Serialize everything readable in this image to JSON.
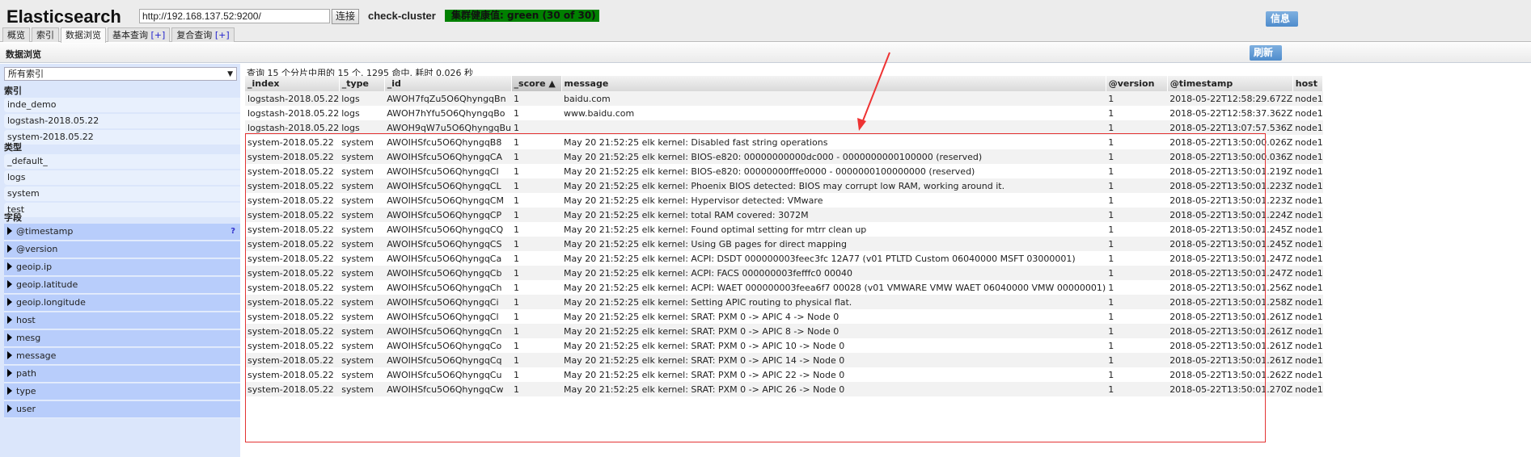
{
  "app": {
    "title": "Elasticsearch",
    "url": "http://192.168.137.52:9200/",
    "connect_label": "连接",
    "cluster_name": "check-cluster",
    "health": "集群健康值: green (30 of 30)",
    "health_color": "#008000",
    "info_label": "信息"
  },
  "tabs": [
    {
      "label": "概览"
    },
    {
      "label": "索引"
    },
    {
      "label": "数据浏览",
      "active": true
    },
    {
      "label": "基本查询",
      "plus": "[+]"
    },
    {
      "label": "复合查询",
      "plus": "[+]"
    }
  ],
  "page": {
    "title": "数据浏览",
    "refresh_label": "刷新"
  },
  "sidebar": {
    "index_select": "所有索引",
    "indices_heading": "索引",
    "indices": [
      "inde_demo",
      "logstash-2018.05.22",
      "system-2018.05.22"
    ],
    "types_heading": "类型",
    "types": [
      "_default_",
      "logs",
      "system",
      "test"
    ],
    "fields_heading": "字段",
    "fields": [
      "@timestamp",
      "@version",
      "geoip.ip",
      "geoip.latitude",
      "geoip.longitude",
      "host",
      "mesg",
      "message",
      "path",
      "type",
      "user"
    ],
    "help_mark": "?"
  },
  "results": {
    "summary": "查询 15 个分片中用的 15 个. 1295 命中. 耗时 0.026 秒",
    "columns": [
      "_index",
      "_type",
      "_id",
      "_score ▲",
      "message",
      "@version",
      "@timestamp",
      "host"
    ],
    "rows": [
      [
        "logstash-2018.05.22",
        "logs",
        "AWOH7fqZu5O6QhyngqBn",
        "1",
        "baidu.com",
        "1",
        "2018-05-22T12:58:29.672Z",
        "node1"
      ],
      [
        "logstash-2018.05.22",
        "logs",
        "AWOH7hYfu5O6QhyngqBo",
        "1",
        "www.baidu.com",
        "1",
        "2018-05-22T12:58:37.362Z",
        "node1"
      ],
      [
        "logstash-2018.05.22",
        "logs",
        "AWOH9qW7u5O6QhyngqBu",
        "1",
        "",
        "1",
        "2018-05-22T13:07:57.536Z",
        "node1"
      ],
      [
        "system-2018.05.22",
        "system",
        "AWOIHSfcu5O6QhyngqB8",
        "1",
        "May 20 21:52:25 elk kernel: Disabled fast string operations",
        "1",
        "2018-05-22T13:50:00.026Z",
        "node1"
      ],
      [
        "system-2018.05.22",
        "system",
        "AWOIHSfcu5O6QhyngqCA",
        "1",
        "May 20 21:52:25 elk kernel: BIOS-e820: 00000000000dc000 - 0000000000100000 (reserved)",
        "1",
        "2018-05-22T13:50:00.036Z",
        "node1"
      ],
      [
        "system-2018.05.22",
        "system",
        "AWOIHSfcu5O6QhyngqCI",
        "1",
        "May 20 21:52:25 elk kernel: BIOS-e820: 00000000fffe0000 - 0000000100000000 (reserved)",
        "1",
        "2018-05-22T13:50:01.219Z",
        "node1"
      ],
      [
        "system-2018.05.22",
        "system",
        "AWOIHSfcu5O6QhyngqCL",
        "1",
        "May 20 21:52:25 elk kernel: Phoenix BIOS detected: BIOS may corrupt low RAM, working around it.",
        "1",
        "2018-05-22T13:50:01.223Z",
        "node1"
      ],
      [
        "system-2018.05.22",
        "system",
        "AWOIHSfcu5O6QhyngqCM",
        "1",
        "May 20 21:52:25 elk kernel: Hypervisor detected: VMware",
        "1",
        "2018-05-22T13:50:01.223Z",
        "node1"
      ],
      [
        "system-2018.05.22",
        "system",
        "AWOIHSfcu5O6QhyngqCP",
        "1",
        "May 20 21:52:25 elk kernel: total RAM covered: 3072M",
        "1",
        "2018-05-22T13:50:01.224Z",
        "node1"
      ],
      [
        "system-2018.05.22",
        "system",
        "AWOIHSfcu5O6QhyngqCQ",
        "1",
        "May 20 21:52:25 elk kernel: Found optimal setting for mtrr clean up",
        "1",
        "2018-05-22T13:50:01.245Z",
        "node1"
      ],
      [
        "system-2018.05.22",
        "system",
        "AWOIHSfcu5O6QhyngqCS",
        "1",
        "May 20 21:52:25 elk kernel: Using GB pages for direct mapping",
        "1",
        "2018-05-22T13:50:01.245Z",
        "node1"
      ],
      [
        "system-2018.05.22",
        "system",
        "AWOIHSfcu5O6QhyngqCa",
        "1",
        "May 20 21:52:25 elk kernel: ACPI: DSDT 000000003feec3fc 12A77 (v01 PTLTD Custom 06040000 MSFT 03000001)",
        "1",
        "2018-05-22T13:50:01.247Z",
        "node1"
      ],
      [
        "system-2018.05.22",
        "system",
        "AWOIHSfcu5O6QhyngqCb",
        "1",
        "May 20 21:52:25 elk kernel: ACPI: FACS 000000003fefffc0 00040",
        "1",
        "2018-05-22T13:50:01.247Z",
        "node1"
      ],
      [
        "system-2018.05.22",
        "system",
        "AWOIHSfcu5O6QhyngqCh",
        "1",
        "May 20 21:52:25 elk kernel: ACPI: WAET 000000003feea6f7 00028 (v01 VMWARE VMW WAET 06040000 VMW 00000001)",
        "1",
        "2018-05-22T13:50:01.256Z",
        "node1"
      ],
      [
        "system-2018.05.22",
        "system",
        "AWOIHSfcu5O6QhyngqCi",
        "1",
        "May 20 21:52:25 elk kernel: Setting APIC routing to physical flat.",
        "1",
        "2018-05-22T13:50:01.258Z",
        "node1"
      ],
      [
        "system-2018.05.22",
        "system",
        "AWOIHSfcu5O6QhyngqCl",
        "1",
        "May 20 21:52:25 elk kernel: SRAT: PXM 0 -> APIC 4 -> Node 0",
        "1",
        "2018-05-22T13:50:01.261Z",
        "node1"
      ],
      [
        "system-2018.05.22",
        "system",
        "AWOIHSfcu5O6QhyngqCn",
        "1",
        "May 20 21:52:25 elk kernel: SRAT: PXM 0 -> APIC 8 -> Node 0",
        "1",
        "2018-05-22T13:50:01.261Z",
        "node1"
      ],
      [
        "system-2018.05.22",
        "system",
        "AWOIHSfcu5O6QhyngqCo",
        "1",
        "May 20 21:52:25 elk kernel: SRAT: PXM 0 -> APIC 10 -> Node 0",
        "1",
        "2018-05-22T13:50:01.261Z",
        "node1"
      ],
      [
        "system-2018.05.22",
        "system",
        "AWOIHSfcu5O6QhyngqCq",
        "1",
        "May 20 21:52:25 elk kernel: SRAT: PXM 0 -> APIC 14 -> Node 0",
        "1",
        "2018-05-22T13:50:01.261Z",
        "node1"
      ],
      [
        "system-2018.05.22",
        "system",
        "AWOIHSfcu5O6QhyngqCu",
        "1",
        "May 20 21:52:25 elk kernel: SRAT: PXM 0 -> APIC 22 -> Node 0",
        "1",
        "2018-05-22T13:50:01.262Z",
        "node1"
      ],
      [
        "system-2018.05.22",
        "system",
        "AWOIHSfcu5O6QhyngqCw",
        "1",
        "May 20 21:52:25 elk kernel: SRAT: PXM 0 -> APIC 26 -> Node 0",
        "1",
        "2018-05-22T13:50:01.270Z",
        "node1"
      ]
    ]
  },
  "annotation": {
    "color": "#e33333"
  }
}
